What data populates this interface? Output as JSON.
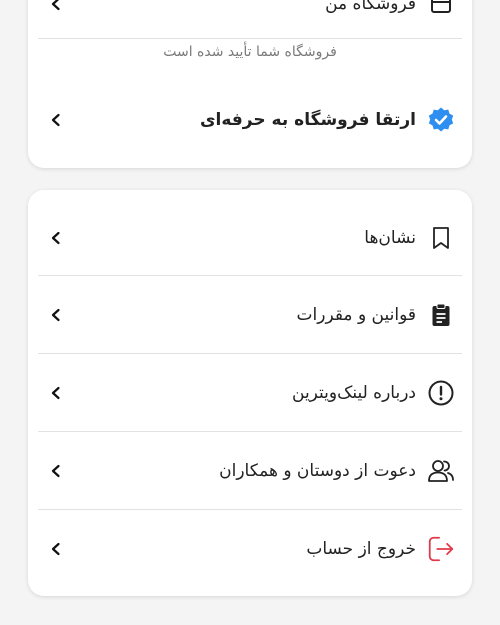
{
  "store_card": {
    "my_store_label": "فروشگاه من",
    "verified_note": "فروشگاه شما تأیید شده است",
    "upgrade_label": "ارتقا فروشگاه به حرفه‌ای",
    "verified_badge_color": "#2f8ff0"
  },
  "menu": {
    "items": [
      {
        "label": "نشان‌ها",
        "icon": "bookmark-icon"
      },
      {
        "label": "قوانین و مقررات",
        "icon": "clipboard-icon"
      },
      {
        "label": "درباره لینک‌ویترین",
        "icon": "info-alert-icon"
      },
      {
        "label": "دعوت از دوستان و همکاران",
        "icon": "users-icon"
      },
      {
        "label": "خروج از حساب",
        "icon": "logout-icon"
      }
    ],
    "logout_color": "#e0394a"
  }
}
